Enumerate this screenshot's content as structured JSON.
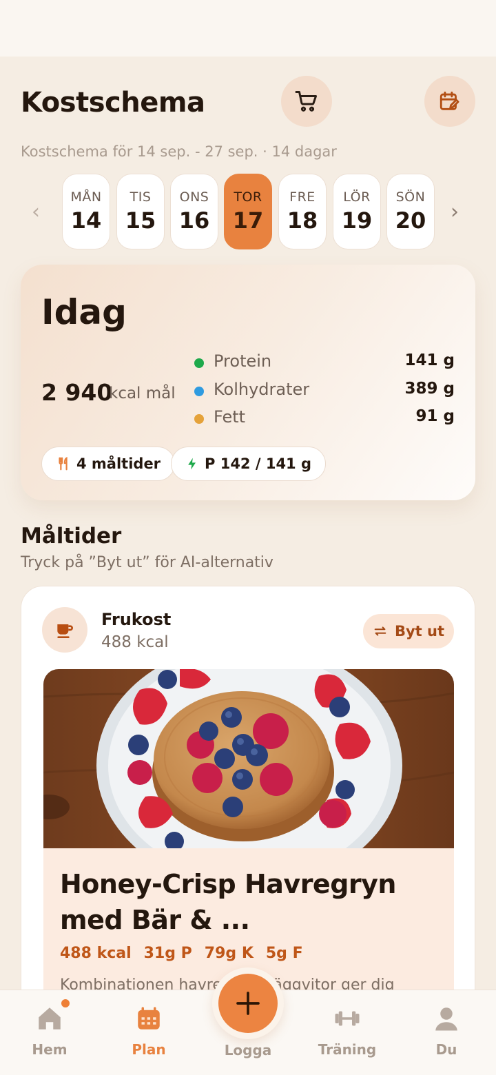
{
  "header": {
    "title": "Kostschema",
    "subtitle": "Kostschema för 14 sep. - 27 sep. · 14 dagar",
    "cart_icon": "cart-icon",
    "calendar_icon": "calendar-edit-icon"
  },
  "week": {
    "days": [
      {
        "name": "MÅN",
        "date": "14"
      },
      {
        "name": "TIS",
        "date": "15"
      },
      {
        "name": "ONS",
        "date": "16"
      },
      {
        "name": "TOR",
        "date": "17"
      },
      {
        "name": "FRE",
        "date": "18"
      },
      {
        "name": "LÖR",
        "date": "19"
      },
      {
        "name": "SÖN",
        "date": "20"
      }
    ],
    "selected": "TOR 17"
  },
  "today": {
    "title": "Idag",
    "kcal": "2 940",
    "kcal_label": "kcal mål",
    "macros": [
      {
        "name": "Protein",
        "value": "141 g",
        "color": "#1ea94b"
      },
      {
        "name": "Kolhydrater",
        "value": "389 g",
        "color": "#2f9be0"
      },
      {
        "name": "Fett",
        "value": "91 g",
        "color": "#e5a23a"
      }
    ],
    "chips": {
      "meals": "4 måltider",
      "protein": "P 142 / 141 g"
    }
  },
  "meals_section": {
    "title": "Måltider",
    "subtitle": "Tryck på ”Byt ut” för AI-alternativ"
  },
  "meal": {
    "type": "Frukost",
    "kcal": "488 kcal",
    "swap_label": "Byt ut",
    "recipe_title": "Honey-Crisp Havregryn med Bär & ...",
    "macros": [
      "488 kcal",
      "31g P",
      "79g K",
      "5g F"
    ],
    "description": "Kombinationen havre... och äggvitor ger dig"
  },
  "tabbar": {
    "home": "Hem",
    "plan": "Plan",
    "log": "Logga",
    "training": "Träning",
    "you": "Du"
  },
  "colors": {
    "accent": "#e8823f",
    "background": "#f5ede3"
  }
}
